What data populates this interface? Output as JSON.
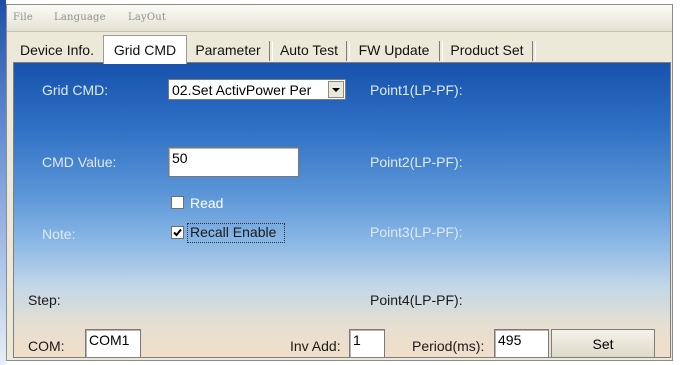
{
  "menubar": {
    "items": [
      "File",
      "Language",
      "LayOut"
    ]
  },
  "tabs": [
    "Device Info.",
    "Grid CMD",
    "Parameter",
    "Auto Test",
    "FW Update",
    "Product Set"
  ],
  "active_tab": "Grid CMD",
  "form": {
    "grid_cmd_label": "Grid CMD:",
    "grid_cmd_value": "02.Set ActivPower Per",
    "cmd_value_label": "CMD Value:",
    "cmd_value": "50",
    "read_label": "Read",
    "read_checked": false,
    "recall_label": "Recall Enable",
    "recall_checked": true,
    "note_label": "Note:",
    "step_label": "Step:",
    "points": [
      "Point1(LP-PF):",
      "Point2(LP-PF):",
      "Point3(LP-PF):",
      "Point4(LP-PF):"
    ]
  },
  "bottom": {
    "com_label": "COM:",
    "com_value": "COM1",
    "inv_add_label": "Inv Add:",
    "inv_add_value": "1",
    "period_label": "Period(ms):",
    "period_value": "495",
    "set_label": "Set"
  }
}
